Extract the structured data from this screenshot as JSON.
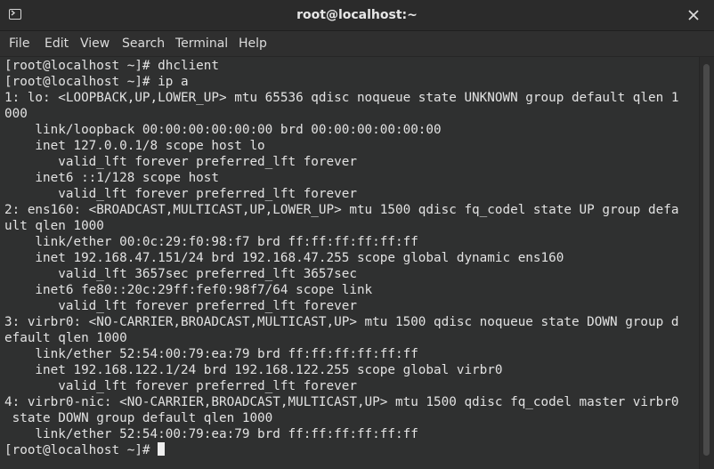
{
  "window": {
    "title": "root@localhost:~"
  },
  "menu": {
    "file": "File",
    "edit": "Edit",
    "view": "View",
    "search": "Search",
    "terminal": "Terminal",
    "help": "Help"
  },
  "terminal": {
    "lines": [
      "[root@localhost ~]# dhclient",
      "[root@localhost ~]# ip a",
      "1: lo: <LOOPBACK,UP,LOWER_UP> mtu 65536 qdisc noqueue state UNKNOWN group default qlen 1",
      "000",
      "    link/loopback 00:00:00:00:00:00 brd 00:00:00:00:00:00",
      "    inet 127.0.0.1/8 scope host lo",
      "       valid_lft forever preferred_lft forever",
      "    inet6 ::1/128 scope host",
      "       valid_lft forever preferred_lft forever",
      "2: ens160: <BROADCAST,MULTICAST,UP,LOWER_UP> mtu 1500 qdisc fq_codel state UP group defa",
      "ult qlen 1000",
      "    link/ether 00:0c:29:f0:98:f7 brd ff:ff:ff:ff:ff:ff",
      "    inet 192.168.47.151/24 brd 192.168.47.255 scope global dynamic ens160",
      "       valid_lft 3657sec preferred_lft 3657sec",
      "    inet6 fe80::20c:29ff:fef0:98f7/64 scope link",
      "       valid_lft forever preferred_lft forever",
      "3: virbr0: <NO-CARRIER,BROADCAST,MULTICAST,UP> mtu 1500 qdisc noqueue state DOWN group d",
      "efault qlen 1000",
      "    link/ether 52:54:00:79:ea:79 brd ff:ff:ff:ff:ff:ff",
      "    inet 192.168.122.1/24 brd 192.168.122.255 scope global virbr0",
      "       valid_lft forever preferred_lft forever",
      "4: virbr0-nic: <NO-CARRIER,BROADCAST,MULTICAST,UP> mtu 1500 qdisc fq_codel master virbr0",
      " state DOWN group default qlen 1000",
      "    link/ether 52:54:00:79:ea:79 brd ff:ff:ff:ff:ff:ff"
    ],
    "prompt": "[root@localhost ~]# "
  },
  "icons": {
    "window_icon": "terminal-icon",
    "close": "close-icon"
  }
}
